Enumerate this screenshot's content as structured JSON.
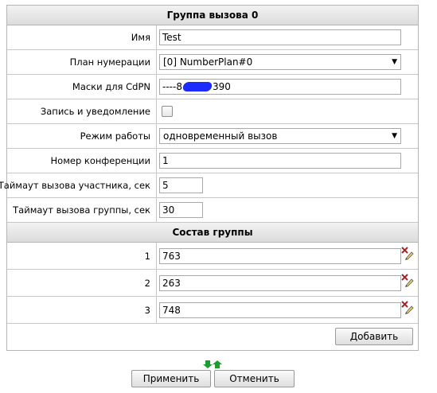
{
  "call_group": {
    "header": "Группа вызова 0",
    "fields": {
      "name": {
        "label": "Имя",
        "value": "Test"
      },
      "numbering_plan": {
        "label": "План нумерации",
        "value": "[0] NumberPlan#0"
      },
      "cdpn_masks": {
        "label": "Маски для CdPN",
        "value_prefix": "----8",
        "value_suffix": "390"
      },
      "record_notify": {
        "label": "Запись и уведомление",
        "checked": false
      },
      "mode": {
        "label": "Режим работы",
        "value": "одновременный вызов"
      },
      "conference_number": {
        "label": "Номер конференции",
        "value": "1"
      },
      "member_timeout": {
        "label": "Таймаут вызова участника, сек",
        "value": "5"
      },
      "group_timeout": {
        "label": "Таймаут вызова группы, сек",
        "value": "30"
      }
    }
  },
  "members": {
    "header": "Состав группы",
    "rows": [
      {
        "index": "1",
        "value": "763"
      },
      {
        "index": "2",
        "value": "263"
      },
      {
        "index": "3",
        "value": "748"
      }
    ],
    "add_label": "Добавить"
  },
  "footer": {
    "apply_label": "Применить",
    "cancel_label": "Отменить"
  },
  "icons": {
    "delete": "delete-x-pencil-icon",
    "sort_arrows": "green-up-down-arrows-icon"
  },
  "colors": {
    "header_bg": "#e4e4e4",
    "border": "#b5b5b5",
    "arrow_green": "#1a9d2a",
    "delete_red": "#c4151b"
  }
}
